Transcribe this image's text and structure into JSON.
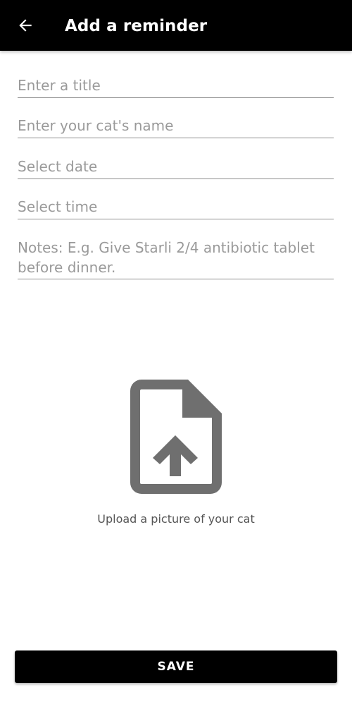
{
  "app_bar": {
    "title": "Add a reminder",
    "back_icon": "arrow-left-icon",
    "background": "#000000"
  },
  "form": {
    "title": {
      "placeholder": "Enter a title",
      "value": ""
    },
    "cat_name": {
      "placeholder": "Enter your cat's name",
      "value": ""
    },
    "date": {
      "placeholder": "Select date",
      "value": ""
    },
    "time": {
      "placeholder": "Select time",
      "value": ""
    },
    "notes": {
      "placeholder": "Notes: E.g. Give Starli 2/4 antibiotic tablet before dinner.",
      "value": ""
    }
  },
  "upload": {
    "icon": "file-upload-icon",
    "icon_color": "#6f6f6f",
    "label": "Upload a picture of your cat"
  },
  "save_button": {
    "label": "SAVE",
    "background": "#000000"
  }
}
